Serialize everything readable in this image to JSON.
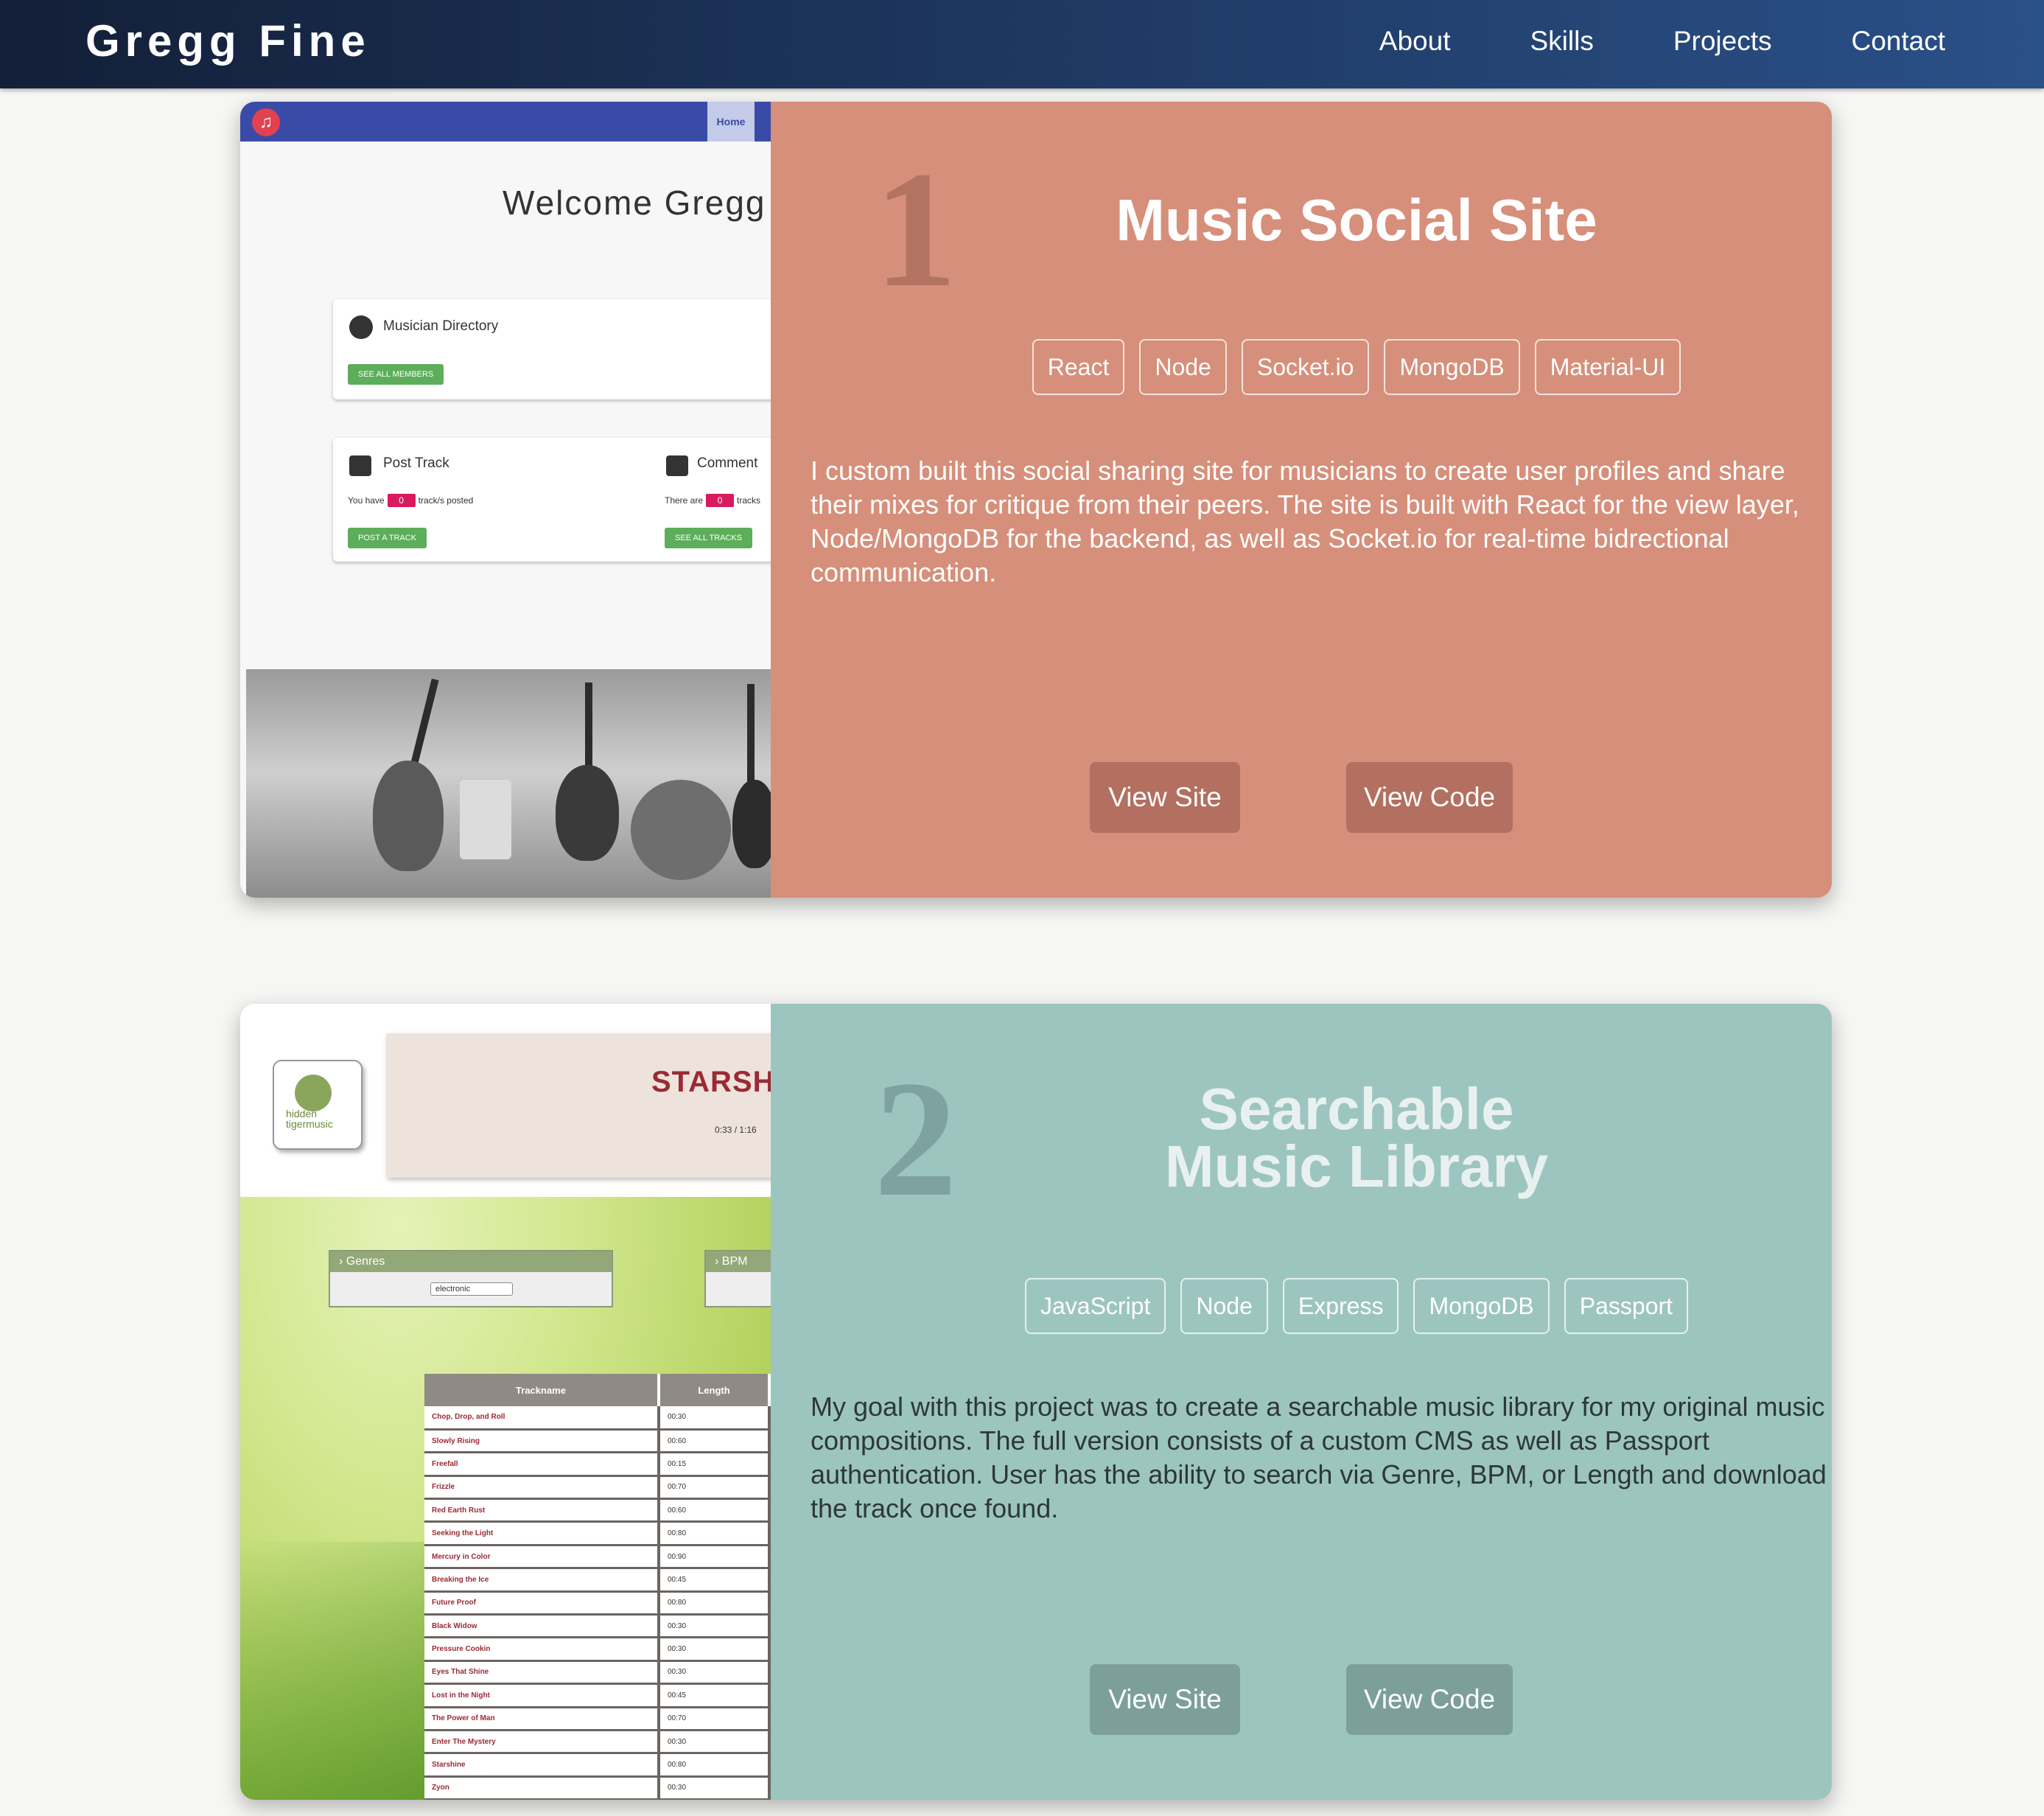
{
  "header": {
    "brand": "Gregg Fine",
    "nav": [
      "About",
      "Skills",
      "Projects",
      "Contact"
    ]
  },
  "projects": [
    {
      "number": "1",
      "title": "Music Social Site",
      "tags": [
        "React",
        "Node",
        "Socket.io",
        "MongoDB",
        "Material-UI"
      ],
      "description": "I custom built this social sharing site for musicians to create user profiles and share their mixes for critique from their peers. The site is built with React for the view layer, Node/MongoDB for the backend, as well as Socket.io for real-time bidrectional communication.",
      "view_site_label": "View Site",
      "view_code_label": "View Code",
      "accent_color": "#d68f7a",
      "screenshot": {
        "nav_home": "Home",
        "welcome": "Welcome Gregg F",
        "directory_title": "Musician Directory",
        "see_all_members": "SEE ALL MEMBERS",
        "post_track_title": "Post Track",
        "you_have": "You have",
        "tracks_posted_count": "0",
        "tracks_posted": "track/s posted",
        "post_a_track": "POST A TRACK",
        "comment_title": "Comment",
        "there_are": "There are",
        "comment_count": "0",
        "tracks_suffix": "tracks",
        "see_all_tracks": "SEE ALL TRACKS"
      }
    },
    {
      "number": "2",
      "title_line1": "Searchable",
      "title_line2": "Music Library",
      "tags": [
        "JavaScript",
        "Node",
        "Express",
        "MongoDB",
        "Passport"
      ],
      "description": "My goal with this project was to create a searchable music library for my original music compositions. The full version consists of a custom CMS as well as Passport authentication. User has the ability to search via Genre, BPM, or Length and download the track once found.",
      "view_site_label": "View Site",
      "view_code_label": "View Code",
      "accent_color": "#9dc5c0",
      "screenshot": {
        "logo_text_1": "hidden",
        "logo_text_2": "tigermusic",
        "now_playing": "STARSH",
        "time": "0:33 / 1:16",
        "genres_label": "Genres",
        "genre_value": "electronic",
        "bpm_label": "BPM",
        "table_headers": [
          "Trackname",
          "Length"
        ],
        "tracks": [
          [
            "Chop, Drop, and Roll",
            "00:30"
          ],
          [
            "Slowly Rising",
            "00:60"
          ],
          [
            "Freefall",
            "00:15"
          ],
          [
            "Frizzle",
            "00:70"
          ],
          [
            "Red Earth Rust",
            "00:60"
          ],
          [
            "Seeking the Light",
            "00:80"
          ],
          [
            "Mercury in Color",
            "00:90"
          ],
          [
            "Breaking the Ice",
            "00:45"
          ],
          [
            "Future Proof",
            "00:80"
          ],
          [
            "Black Widow",
            "00:30"
          ],
          [
            "Pressure Cookin",
            "00:30"
          ],
          [
            "Eyes That Shine",
            "00:30"
          ],
          [
            "Lost in the Night",
            "00:45"
          ],
          [
            "The Power of Man",
            "00:70"
          ],
          [
            "Enter The Mystery",
            "00:30"
          ],
          [
            "Starshine",
            "00:80"
          ],
          [
            "Zyon",
            "00:30"
          ]
        ]
      }
    }
  ]
}
